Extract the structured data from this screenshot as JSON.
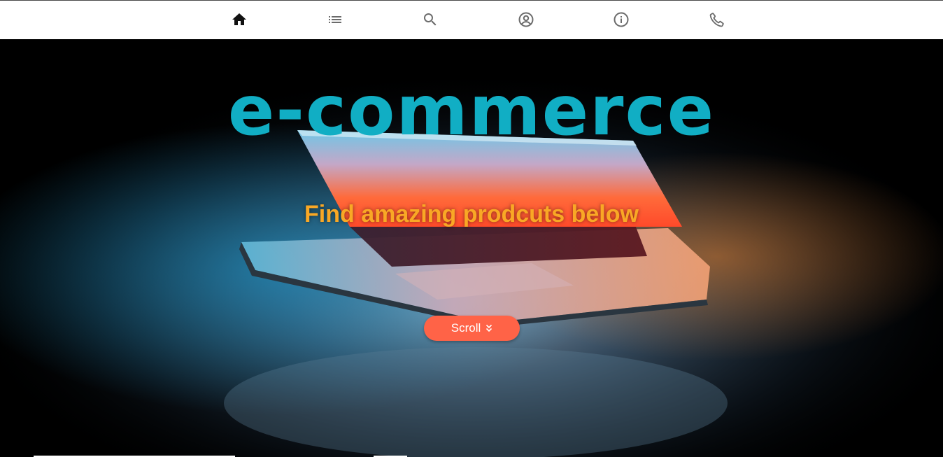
{
  "nav": {
    "items": [
      {
        "icon": "home-icon",
        "label": "Home"
      },
      {
        "icon": "list-icon",
        "label": "Products"
      },
      {
        "icon": "search-icon",
        "label": "Search"
      },
      {
        "icon": "account-icon",
        "label": "Account"
      },
      {
        "icon": "info-icon",
        "label": "About"
      },
      {
        "icon": "phone-icon",
        "label": "Contact"
      }
    ]
  },
  "hero": {
    "title": "e-commerce",
    "subtitle": "Find amazing prodcuts below",
    "scroll_label": "Scroll",
    "scroll_icon": "double-chevron-down-icon"
  },
  "colors": {
    "title": "#11aec4",
    "subtitle": "#f9a825",
    "scroll_button": "#ff6347",
    "nav_active_icon": "#111111",
    "nav_icon": "#6b6b6b"
  }
}
